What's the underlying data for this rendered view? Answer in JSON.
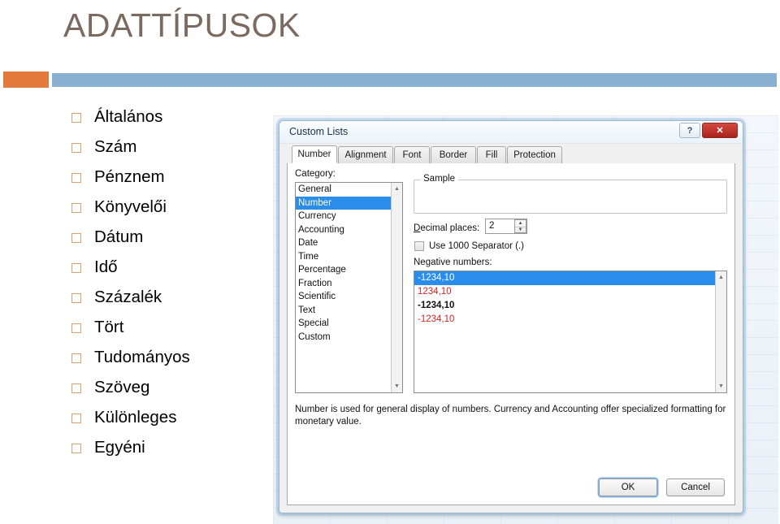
{
  "slide": {
    "title": "ADATTÍPUSOK",
    "accent_orange": "#e3793c",
    "accent_blue": "#8bb1d2",
    "title_color": "#7b6a5f",
    "bullets": [
      {
        "label": "Általános"
      },
      {
        "label": "Szám"
      },
      {
        "label": "Pénznem"
      },
      {
        "label": "Könyvelői"
      },
      {
        "label": "Dátum"
      },
      {
        "label": "Idő"
      },
      {
        "label": "Százalék"
      },
      {
        "label": "Tört"
      },
      {
        "label": "Tudományos"
      },
      {
        "label": "Szöveg"
      },
      {
        "label": "Különleges"
      },
      {
        "label": "Egyéni"
      }
    ]
  },
  "dialog": {
    "title": "Custom Lists",
    "help_glyph": "?",
    "close_glyph": "✕",
    "tabs": [
      {
        "label": "Number",
        "active": true
      },
      {
        "label": "Alignment",
        "active": false
      },
      {
        "label": "Font",
        "active": false
      },
      {
        "label": "Border",
        "active": false
      },
      {
        "label": "Fill",
        "active": false
      },
      {
        "label": "Protection",
        "active": false
      }
    ],
    "category": {
      "label": "Category:",
      "items": [
        {
          "label": "General",
          "selected": false
        },
        {
          "label": "Number",
          "selected": true
        },
        {
          "label": "Currency",
          "selected": false
        },
        {
          "label": "Accounting",
          "selected": false
        },
        {
          "label": "Date",
          "selected": false
        },
        {
          "label": "Time",
          "selected": false
        },
        {
          "label": "Percentage",
          "selected": false
        },
        {
          "label": "Fraction",
          "selected": false
        },
        {
          "label": "Scientific",
          "selected": false
        },
        {
          "label": "Text",
          "selected": false
        },
        {
          "label": "Special",
          "selected": false
        },
        {
          "label": "Custom",
          "selected": false
        }
      ],
      "scroll_up_glyph": "▲",
      "scroll_down_glyph": "▼"
    },
    "sample": {
      "legend": "Sample",
      "value": ""
    },
    "decimal_places": {
      "label": "Decimal places:",
      "value": "2",
      "up_glyph": "▲",
      "down_glyph": "▼"
    },
    "thousand_separator": {
      "label": "Use  1000 Separator (.)",
      "checked": false
    },
    "negative_numbers": {
      "label": "Negative numbers:",
      "items": [
        {
          "text": "-1234,10",
          "color": "#ffffff",
          "selected": true,
          "bold": false
        },
        {
          "text": "1234,10",
          "color": "#e02020",
          "selected": false,
          "bold": false
        },
        {
          "text": "-1234,10",
          "color": "#111111",
          "selected": false,
          "bold": true
        },
        {
          "text": "-1234,10",
          "color": "#e02020",
          "selected": false,
          "bold": false
        }
      ],
      "selected_background": "#2a8ceb",
      "scroll_up_glyph": "▲",
      "scroll_down_glyph": "▼"
    },
    "description": "Number is used for general display of numbers.  Currency and Accounting offer specialized formatting for monetary value.",
    "buttons": {
      "ok": "OK",
      "cancel": "Cancel"
    }
  }
}
